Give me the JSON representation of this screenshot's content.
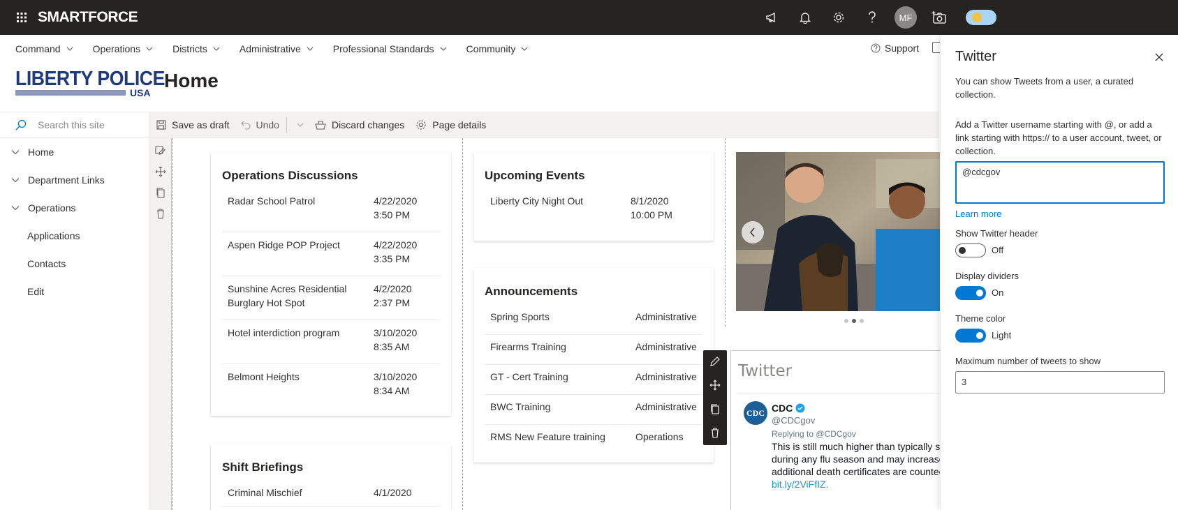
{
  "suite": {
    "brand": "SMARTFORCE",
    "avatar_initials": "MF"
  },
  "topnav": {
    "items": [
      "Command",
      "Operations",
      "Districts",
      "Administrative",
      "Professional Standards",
      "Community"
    ],
    "support": "Support"
  },
  "header": {
    "logo_top": "LIBERTY POLICE",
    "logo_bottom": "USA",
    "page_title": "Home"
  },
  "leftnav": {
    "search_placeholder": "Search this site",
    "items": [
      {
        "label": "Home",
        "expandable": true
      },
      {
        "label": "Department Links",
        "expandable": true
      },
      {
        "label": "Operations",
        "expandable": true
      },
      {
        "label": "Applications",
        "expandable": false
      },
      {
        "label": "Contacts",
        "expandable": false
      },
      {
        "label": "Edit",
        "expandable": false
      }
    ]
  },
  "cmdbar": {
    "save_draft": "Save as draft",
    "undo": "Undo",
    "discard": "Discard changes",
    "page_details": "Page details"
  },
  "ops_discussions": {
    "title": "Operations Discussions",
    "rows": [
      {
        "name": "Radar School Patrol",
        "date": "4/22/2020",
        "time": "3:50 PM"
      },
      {
        "name": "Aspen Ridge POP Project",
        "date": "4/22/2020",
        "time": "3:35 PM"
      },
      {
        "name": "Sunshine Acres Residential Burglary Hot Spot",
        "date": "4/2/2020",
        "time": "2:37 PM"
      },
      {
        "name": "Hotel interdiction program",
        "date": "3/10/2020",
        "time": "8:35 AM"
      },
      {
        "name": "Belmont Heights",
        "date": "3/10/2020",
        "time": "8:34 AM"
      }
    ]
  },
  "shift_briefings": {
    "title": "Shift Briefings",
    "rows": [
      {
        "name": "Criminal Mischief",
        "date": "4/1/2020"
      }
    ]
  },
  "upcoming_events": {
    "title": "Upcoming Events",
    "rows": [
      {
        "name": "Liberty City Night Out",
        "date": "8/1/2020",
        "time": "10:00 PM"
      }
    ]
  },
  "announcements": {
    "title": "Announcements",
    "rows": [
      {
        "name": "Spring Sports",
        "category": "Administrative"
      },
      {
        "name": "Firearms Training",
        "category": "Administrative"
      },
      {
        "name": "GT - Cert Training",
        "category": "Administrative"
      },
      {
        "name": "BWC Training",
        "category": "Administrative"
      },
      {
        "name": "RMS New Feature training",
        "category": "Operations"
      }
    ]
  },
  "twitter_webpart": {
    "title": "Twitter",
    "avatar_text": "CDC",
    "name": "CDC",
    "handle": "@CDCgov",
    "reply": "Replying to @CDCgov",
    "text_lines": [
      "This is still much higher than typically s",
      "during any flu season and may increase",
      "additional death certificates are counted"
    ],
    "link": "bit.ly/2ViFfIZ."
  },
  "pane": {
    "title": "Twitter",
    "intro": "You can show Tweets from a user, a curated collection.",
    "instructions": "Add a Twitter username starting with @, or add a link starting with https:// to a user account, tweet, or collection.",
    "username_value": "@cdcgov",
    "learn_more": "Learn more",
    "show_header_label": "Show Twitter header",
    "show_header_state": "Off",
    "dividers_label": "Display dividers",
    "dividers_state": "On",
    "theme_label": "Theme color",
    "theme_state": "Light",
    "max_tweets_label": "Maximum number of tweets to show",
    "max_tweets_value": "3"
  },
  "colors": {
    "suitebar": "#252423",
    "accent": "#0078d4",
    "logo_navy": "#1f3a7a"
  }
}
